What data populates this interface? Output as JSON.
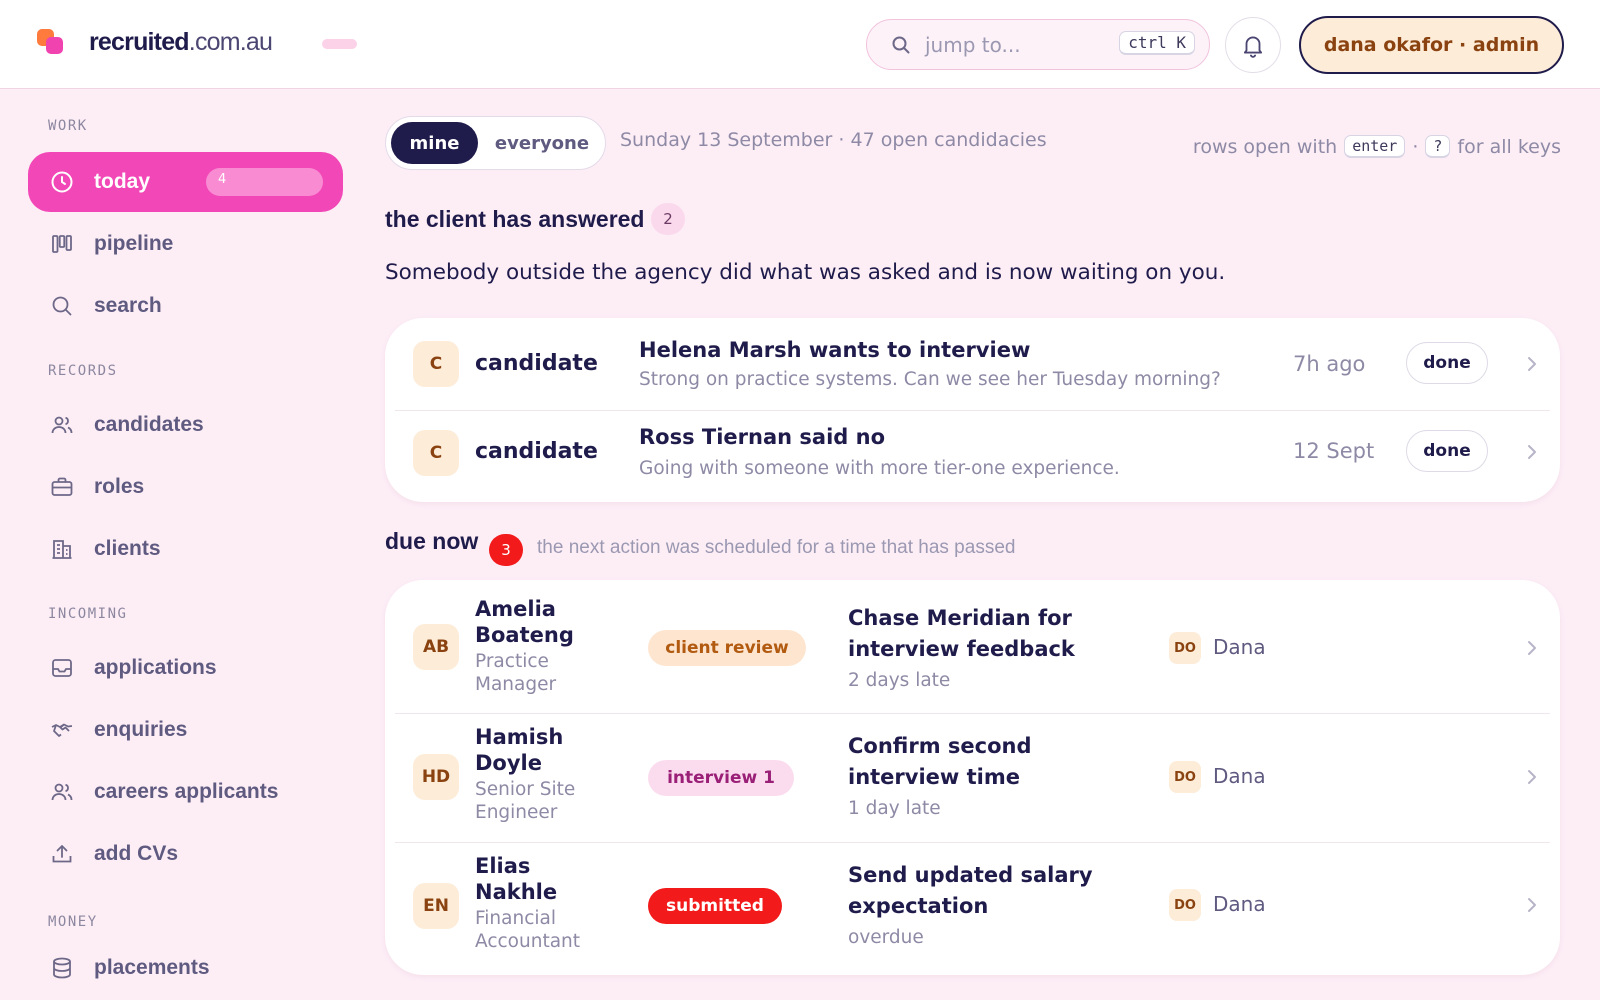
{
  "header": {
    "brand": "recruited",
    "domain": ".com.au",
    "search_placeholder": "jump to...",
    "search_shortcut": "ctrl K",
    "user_label": "dana okafor · admin"
  },
  "sidebar": {
    "sections": {
      "work": "WORK",
      "records": "RECORDS",
      "incoming": "INCOMING",
      "money": "MONEY"
    },
    "items": [
      {
        "label": "today",
        "icon": "clock-icon",
        "badge": "4",
        "active": true
      },
      {
        "label": "pipeline",
        "icon": "kanban-icon"
      },
      {
        "label": "search",
        "icon": "search-icon"
      },
      {
        "label": "candidates",
        "icon": "users-icon"
      },
      {
        "label": "roles",
        "icon": "briefcase-icon"
      },
      {
        "label": "clients",
        "icon": "building-icon"
      },
      {
        "label": "applications",
        "icon": "inbox-icon"
      },
      {
        "label": "enquiries",
        "icon": "handshake-icon"
      },
      {
        "label": "careers applicants",
        "icon": "users-icon"
      },
      {
        "label": "add CVs",
        "icon": "upload-icon"
      },
      {
        "label": "placements",
        "icon": "database-icon"
      }
    ]
  },
  "main": {
    "toggle": {
      "mine": "mine",
      "everyone": "everyone",
      "selected": "mine"
    },
    "date_line": "Sunday 13 September · 47 open candidacies",
    "keys_hint": {
      "pre": "rows open with",
      "key1": "enter",
      "mid": "·",
      "key2": "?",
      "post": "for all keys"
    },
    "answered": {
      "title": "the client has answered",
      "count": "2",
      "description": "Somebody outside the agency did what was asked and is now waiting on you.",
      "rows": [
        {
          "avatar": "C",
          "kind": "candidate",
          "title": "Helena Marsh wants to interview",
          "subtitle": "Strong on practice systems. Can we see her Tuesday morning?",
          "time": "7h ago",
          "action": "done"
        },
        {
          "avatar": "C",
          "kind": "candidate",
          "title": "Ross Tiernan said no",
          "subtitle": "Going with someone with more tier-one experience.",
          "time": "12 Sept",
          "action": "done"
        }
      ]
    },
    "due": {
      "title": "due now",
      "count": "3",
      "subtitle": "the next action was scheduled for a time that has passed",
      "rows": [
        {
          "initials": "AB",
          "name_l1": "Amelia",
          "name_l2": "Boateng",
          "role_l1": "Practice",
          "role_l2": "Manager",
          "stage": "client review",
          "action_l1": "Chase Meridian for",
          "action_l2": "interview feedback",
          "late": "2 days late",
          "owner_initials": "DO",
          "owner": "Dana"
        },
        {
          "initials": "HD",
          "name_l1": "Hamish",
          "name_l2": "Doyle",
          "role_l1": "Senior Site",
          "role_l2": "Engineer",
          "stage": "interview 1",
          "action_l1": "Confirm second",
          "action_l2": "interview time",
          "late": "1 day late",
          "owner_initials": "DO",
          "owner": "Dana"
        },
        {
          "initials": "EN",
          "name_l1": "Elias",
          "name_l2": "Nakhle",
          "role_l1": "Financial",
          "role_l2": "Accountant",
          "stage": "submitted",
          "action_l1": "Send updated salary",
          "action_l2": "expectation",
          "late": "overdue",
          "owner_initials": "DO",
          "owner": "Dana"
        }
      ]
    }
  },
  "colors": {
    "accent": "#f248b7",
    "navy": "#1f1b4b",
    "danger": "#f21a1a",
    "background": "#fdeef6"
  }
}
